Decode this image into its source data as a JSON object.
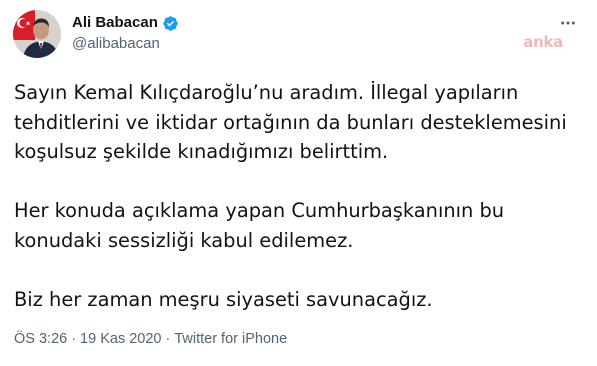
{
  "tweet": {
    "author": {
      "display_name": "Ali Babacan",
      "handle": "@alibabacan",
      "verified_icon": "verified-badge-icon",
      "verified_color": "#1d9bf0"
    },
    "more_icon": "more-horizontal-icon",
    "watermark": "anka",
    "paragraphs": [
      "Sayın Kemal Kılıçdaroğlu’nu aradım. İllegal yapıların tehditlerini ve iktidar ortağının da bunları desteklemesini koşulsuz şekilde kınadığımızı belirttim.",
      "Her konuda açıklama yapan Cumhurbaşkanının bu konudaki sessizliği kabul edilemez.",
      "Biz her zaman meşru siyaseti savunacağız."
    ],
    "meta": {
      "time": "ÖS 3:26",
      "separator": "·",
      "date": "19 Kas 2020",
      "source": "Twitter for iPhone"
    }
  }
}
